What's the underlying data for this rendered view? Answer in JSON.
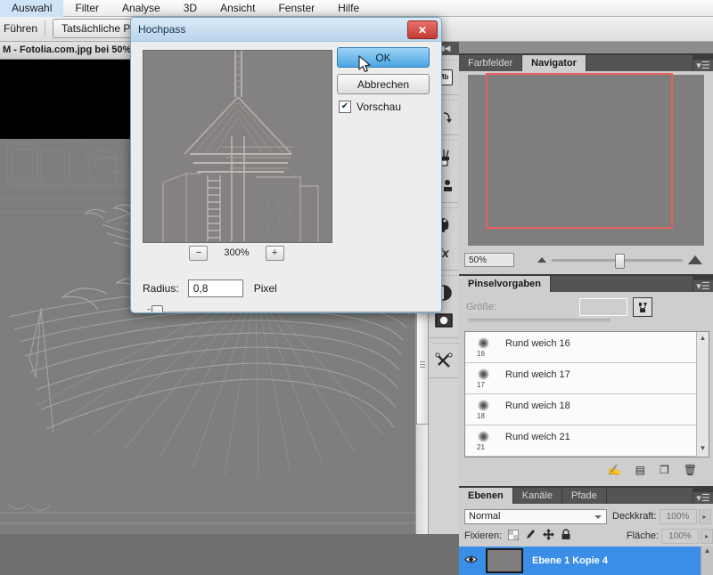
{
  "menubar": {
    "items": [
      {
        "label": "Auswahl"
      },
      {
        "label": "Filter"
      },
      {
        "label": "Analyse"
      },
      {
        "label": "3D"
      },
      {
        "label": "Ansicht"
      },
      {
        "label": "Fenster"
      },
      {
        "label": "Hilfe"
      }
    ]
  },
  "options_bar": {
    "run_label": "Führen",
    "actual_pixels_label": "Tatsächliche Pixel"
  },
  "document_tab": {
    "title": "M - Fotolia.com.jpg bei 50%"
  },
  "icon_dock": {
    "collapse_label": "◀◀",
    "items": [
      {
        "name": "mini-bridge-icon",
        "glyph": "Mb"
      },
      {
        "name": "history-icon",
        "glyph": "⇲"
      },
      {
        "name": "brush-icon",
        "glyph": "🖌"
      },
      {
        "name": "clone-source-icon",
        "glyph": "⌸"
      },
      {
        "name": "color-palette-icon",
        "glyph": "🎨"
      },
      {
        "name": "layer-styles-fx-icon",
        "glyph": "fx"
      },
      {
        "name": "adjustments-icon",
        "glyph": "◑"
      },
      {
        "name": "masks-icon",
        "glyph": "◉"
      },
      {
        "name": "tools-icon",
        "glyph": "✂"
      }
    ]
  },
  "navigator_panel": {
    "tabs": [
      {
        "label": "Farbfelder",
        "active": false
      },
      {
        "label": "Navigator",
        "active": true
      }
    ],
    "menu_glyph": "▾☰",
    "zoom_value": "50%",
    "view_box_color": "#e8605f"
  },
  "brush_panel": {
    "tabs": [
      {
        "label": "Pinselvorgaben",
        "active": true
      }
    ],
    "menu_glyph": "▾☰",
    "size_label": "Größe:",
    "size_value": "",
    "presets": [
      {
        "name": "Rund weich 16",
        "size": "16"
      },
      {
        "name": "Rund weich 17",
        "size": "17"
      },
      {
        "name": "Rund weich 18",
        "size": "18"
      },
      {
        "name": "Rund weich 21",
        "size": "21"
      }
    ],
    "footer_icons": [
      {
        "name": "load-brush-icon",
        "glyph": "✍"
      },
      {
        "name": "brush-panel-icon",
        "glyph": "▤"
      },
      {
        "name": "new-brush-icon",
        "glyph": "❐"
      },
      {
        "name": "delete-brush-icon",
        "glyph": "🗑"
      }
    ]
  },
  "layers_panel": {
    "tabs": [
      {
        "label": "Ebenen",
        "active": true
      },
      {
        "label": "Kanäle",
        "active": false
      },
      {
        "label": "Pfade",
        "active": false
      }
    ],
    "menu_glyph": "▾☰",
    "blend_mode": "Normal",
    "opacity_label": "Deckkraft:",
    "opacity_value": "100%",
    "lock_label": "Fixieren:",
    "fill_label": "Fläche:",
    "fill_value": "100%",
    "lock_icons": [
      {
        "name": "lock-transparency-icon",
        "glyph": "▨"
      },
      {
        "name": "lock-image-icon",
        "glyph": "🖌"
      },
      {
        "name": "lock-position-icon",
        "glyph": "✥"
      },
      {
        "name": "lock-all-icon",
        "glyph": "🔒"
      }
    ],
    "layers": [
      {
        "name": "Ebene 1 Kopie 4",
        "visible": true,
        "selected": true
      }
    ],
    "selection_color": "#3b8ee8"
  },
  "dialog": {
    "title": "Hochpass",
    "close_glyph": "✕",
    "ok_label": "OK",
    "cancel_label": "Abbrechen",
    "preview_label": "Vorschau",
    "preview_checked_glyph": "✔",
    "zoom_out_glyph": "−",
    "zoom_in_glyph": "+",
    "zoom_level": "300%",
    "radius_label": "Radius:",
    "radius_value": "0,8",
    "radius_unit": "Pixel",
    "accent_color": "#4ca5e4",
    "titlebar_color": "#b9d4ec"
  }
}
